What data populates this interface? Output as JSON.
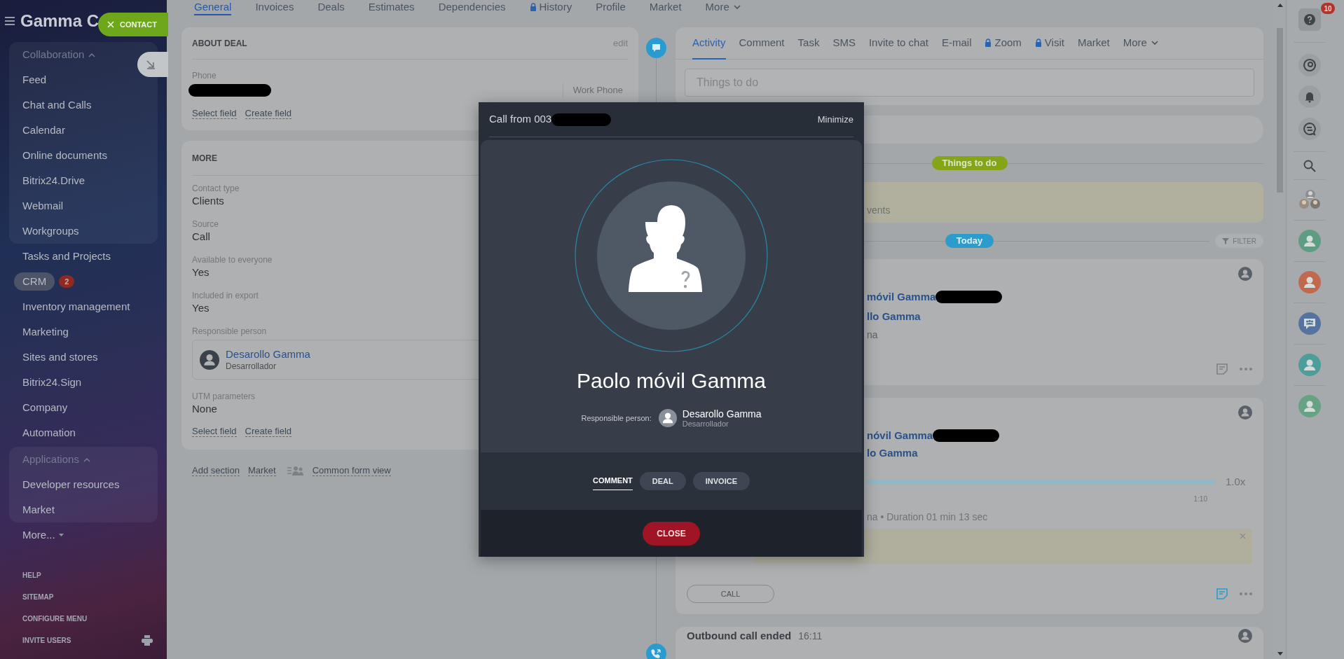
{
  "sidebar": {
    "title": "Gamma C",
    "menu": [
      {
        "kind": "group",
        "label": "Collaboration",
        "expanded": true,
        "selected": false,
        "children": [
          {
            "label": "Feed",
            "selected": false
          },
          {
            "label": "Chat and Calls",
            "selected": false
          },
          {
            "label": "Calendar",
            "selected": false
          },
          {
            "label": "Online documents",
            "selected": false
          },
          {
            "label": "Bitrix24.Drive",
            "selected": false
          },
          {
            "label": "Webmail",
            "selected": false
          },
          {
            "label": "Workgroups",
            "selected": false
          }
        ]
      },
      {
        "kind": "link",
        "label": "Tasks and Projects",
        "selected": false
      },
      {
        "kind": "link",
        "label": "CRM",
        "selected": true,
        "counter": "2"
      },
      {
        "kind": "link",
        "label": "Inventory management",
        "selected": false
      },
      {
        "kind": "link",
        "label": "Marketing",
        "selected": false
      },
      {
        "kind": "link",
        "label": "Sites and stores",
        "selected": false
      },
      {
        "kind": "link",
        "label": "Bitrix24.Sign",
        "selected": false
      },
      {
        "kind": "link",
        "label": "Company",
        "selected": false
      },
      {
        "kind": "link",
        "label": "Automation",
        "selected": false
      },
      {
        "kind": "group",
        "label": "Applications",
        "expanded": true,
        "selected": false,
        "children": [
          {
            "label": "Developer resources",
            "selected": false
          },
          {
            "label": "Market",
            "selected": false
          }
        ]
      },
      {
        "kind": "more",
        "label": "More...",
        "selected": false
      }
    ],
    "footer_links": [
      "HELP",
      "SITEMAP",
      "CONFIGURE MENU",
      "INVITE USERS"
    ]
  },
  "contact_button": {
    "label": "CONTACT"
  },
  "top_tabs": [
    {
      "label": "General",
      "kind": "tab",
      "selected": true,
      "locked": false
    },
    {
      "label": "Invoices",
      "kind": "tab",
      "selected": false,
      "locked": false
    },
    {
      "label": "Deals",
      "kind": "tab",
      "selected": false,
      "locked": false
    },
    {
      "label": "Estimates",
      "kind": "tab",
      "selected": false,
      "locked": false
    },
    {
      "label": "Dependencies",
      "kind": "tab",
      "selected": false,
      "locked": false
    },
    {
      "label": "History",
      "kind": "tab",
      "selected": false,
      "locked": true
    },
    {
      "label": "Profile",
      "kind": "tab",
      "selected": false,
      "locked": false
    },
    {
      "label": "Market",
      "kind": "tab",
      "selected": false,
      "locked": false
    },
    {
      "label": "More",
      "kind": "menu",
      "selected": false,
      "locked": false
    }
  ],
  "about_deal": {
    "title": "ABOUT DEAL",
    "edit": "edit",
    "phone_label": "Phone",
    "phone_type": "Work Phone",
    "links": [
      "Select field",
      "Create field"
    ]
  },
  "more_section": {
    "title": "MORE",
    "fields": [
      {
        "kind": "text",
        "label": "Contact type",
        "value": "Clients"
      },
      {
        "kind": "text",
        "label": "Source",
        "value": "Call"
      },
      {
        "kind": "text",
        "label": "Available to everyone",
        "value": "Yes"
      },
      {
        "kind": "text",
        "label": "Included in export",
        "value": "Yes"
      },
      {
        "kind": "person",
        "label": "Responsible person",
        "name": "Desarollo Gamma",
        "position": "Desarrollador"
      },
      {
        "kind": "text",
        "label": "UTM parameters",
        "value": "None"
      }
    ],
    "links": [
      "Select field",
      "Create field"
    ]
  },
  "form_links": [
    {
      "kind": "link",
      "label": "Add section"
    },
    {
      "kind": "link",
      "label": "Market"
    },
    {
      "kind": "view",
      "label": "Common form view"
    }
  ],
  "activity": {
    "tabs": [
      {
        "label": "Activity",
        "kind": "tab",
        "selected": true,
        "locked": false
      },
      {
        "label": "Comment",
        "kind": "tab",
        "selected": false,
        "locked": false
      },
      {
        "label": "Task",
        "kind": "tab",
        "selected": false,
        "locked": false
      },
      {
        "label": "SMS",
        "kind": "tab",
        "selected": false,
        "locked": false
      },
      {
        "label": "Invite to chat",
        "kind": "tab",
        "selected": false,
        "locked": false
      },
      {
        "label": "E-mail",
        "kind": "tab",
        "selected": false,
        "locked": false
      },
      {
        "label": "Zoom",
        "kind": "tab",
        "selected": false,
        "locked": true
      },
      {
        "label": "Visit",
        "kind": "tab",
        "selected": false,
        "locked": true
      },
      {
        "label": "Market",
        "kind": "tab",
        "selected": false,
        "locked": false
      },
      {
        "label": "More",
        "kind": "menu",
        "selected": false,
        "locked": false
      }
    ],
    "input": {
      "placeholder": "Things to do"
    }
  },
  "timeline": {
    "section_pill": "Things to do",
    "notice_fragment": "vents",
    "day_pill": "Today",
    "filter": "FILTER",
    "entries": [
      {
        "kind": "call",
        "note_active": false,
        "lines": [
          {
            "kind": "link",
            "text": "móvil Gamma",
            "redacted": true
          },
          {
            "kind": "link",
            "text": "llo Gamma",
            "redacted": false
          },
          {
            "kind": "note",
            "text": "na",
            "redacted": false
          }
        ]
      },
      {
        "kind": "recording",
        "note_active": true,
        "lines": [
          {
            "kind": "link",
            "text": "nóvil Gamma",
            "redacted": true
          },
          {
            "kind": "link",
            "text": "lo Gamma",
            "redacted": false
          }
        ],
        "player": {
          "level": 1,
          "speed": "1.0x",
          "time": "1:10"
        },
        "detail": "na • Duration 01 min 13 sec",
        "call_button": "CALL"
      },
      {
        "kind": "header",
        "title": "Outbound call ended",
        "time": "16:11"
      }
    ]
  },
  "call_popup": {
    "title": "Call from 003",
    "minimize": "Minimize",
    "caller_name": "Paolo móvil Gamma",
    "responsible_label": "Responsible person:",
    "responsible_name": "Desarollo Gamma",
    "responsible_position": "Desarrollador",
    "tabs": [
      {
        "label": "COMMENT",
        "selected": true
      },
      {
        "label": "DEAL",
        "selected": false
      },
      {
        "label": "INVOICE",
        "selected": false
      }
    ],
    "close": "CLOSE"
  },
  "right_rail": {
    "help_badge": "10",
    "contacts": [
      {
        "kind": "photos"
      },
      {
        "kind": "user",
        "color": "#5f9c84"
      },
      {
        "kind": "user",
        "color": "#c1694f"
      },
      {
        "kind": "group_chat",
        "color": "#56729e"
      },
      {
        "kind": "user",
        "color": "#4d9d9a"
      },
      {
        "kind": "user",
        "color": "#66a283"
      }
    ]
  }
}
